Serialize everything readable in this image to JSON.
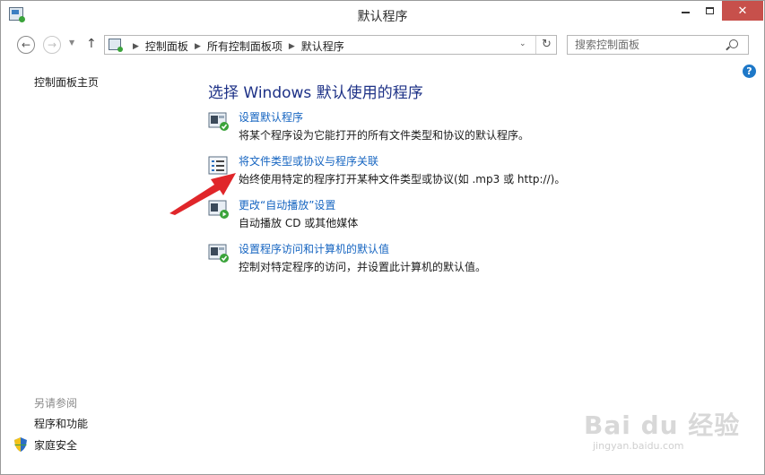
{
  "window": {
    "title": "默认程序",
    "minimize_icon": "minimize-icon",
    "maximize_icon": "maximize-icon",
    "close_glyph": "✕"
  },
  "nav": {
    "back_glyph": "←",
    "forward_glyph": "→",
    "up_glyph": "↑",
    "breadcrumbs": [
      "控制面板",
      "所有控制面板项",
      "默认程序"
    ],
    "refresh_glyph": "↻",
    "search_placeholder": "搜索控制面板"
  },
  "left_pane": {
    "home_link": "控制面板主页",
    "see_also_label": "另请参阅",
    "see_also_links": [
      "程序和功能",
      "家庭安全"
    ]
  },
  "main": {
    "heading": "选择 Windows 默认使用的程序",
    "tasks": [
      {
        "link": "设置默认程序",
        "description": "将某个程序设为它能打开的所有文件类型和协议的默认程序。",
        "icon": "default-programs-icon"
      },
      {
        "link": "将文件类型或协议与程序关联",
        "description": "始终使用特定的程序打开某种文件类型或协议(如 .mp3 或 http://)。",
        "icon": "file-association-icon"
      },
      {
        "link": "更改“自动播放”设置",
        "description": "自动播放 CD 或其他媒体",
        "icon": "autoplay-icon"
      },
      {
        "link": "设置程序访问和计算机的默认值",
        "description": "控制对特定程序的访问，并设置此计算机的默认值。",
        "icon": "program-access-icon"
      }
    ]
  },
  "help_glyph": "?",
  "watermark": {
    "logo": "Bai du 经验",
    "url": "jingyan.baidu.com"
  },
  "colors": {
    "link": "#1665c1",
    "heading": "#1e3287",
    "close_button": "#c7504b",
    "annotation_arrow": "#e0262a"
  }
}
